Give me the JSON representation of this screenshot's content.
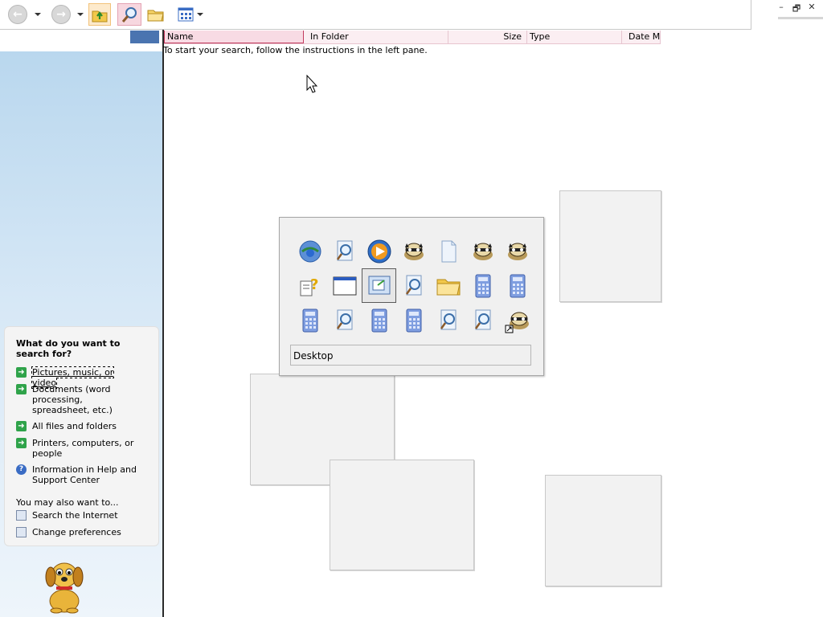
{
  "toolbar": {
    "back_icon": "back-arrow",
    "forward_icon": "forward-arrow",
    "up_icon": "folder-up",
    "search_icon": "magnifier",
    "folders_icon": "folder",
    "views_icon": "views-grid"
  },
  "window_controls": {
    "minimize": "–",
    "restore": "🗗",
    "close": "✕"
  },
  "columns": [
    "Name",
    "In Folder",
    "Size",
    "Type",
    "Date M"
  ],
  "results_message": "To start your search, follow the instructions in the left pane.",
  "search_pane": {
    "question": "What do you want to search for?",
    "options": [
      {
        "label": "Pictures, music, or video",
        "icon": "green-arrow"
      },
      {
        "label": "Documents (word processing, spreadsheet, etc.)",
        "icon": "green-arrow"
      },
      {
        "label": "All files and folders",
        "icon": "green-arrow"
      },
      {
        "label": "Printers, computers, or people",
        "icon": "green-arrow"
      },
      {
        "label": "Information in Help and Support Center",
        "icon": "help-question"
      }
    ],
    "also_label": "You may also want to...",
    "extras": [
      {
        "label": "Search the Internet",
        "icon": "search-globe"
      },
      {
        "label": "Change preferences",
        "icon": "preferences-page"
      }
    ]
  },
  "task_switcher": {
    "label": "Desktop",
    "icons": [
      "ie-globe",
      "search-doc",
      "media-player",
      "raccoon",
      "blank-doc",
      "raccoon",
      "raccoon",
      "help-doc",
      "window",
      "desktop",
      "search-doc",
      "folder",
      "calculator",
      "calculator",
      "calculator",
      "search-doc",
      "calculator",
      "calculator",
      "search-doc",
      "search-doc",
      "raccoon-shortcut"
    ],
    "selected_index": 9
  }
}
